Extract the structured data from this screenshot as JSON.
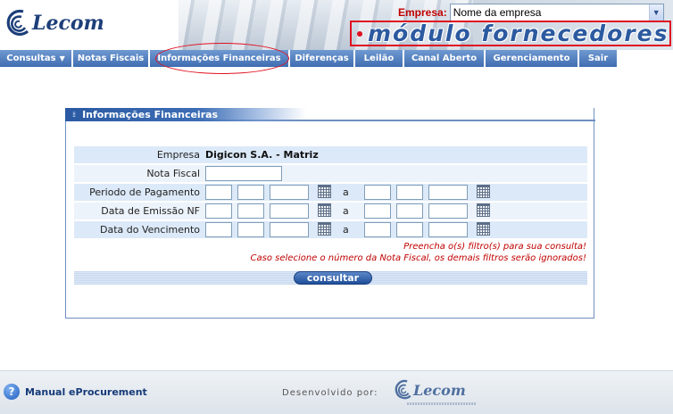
{
  "header": {
    "logo_text": "Lecom",
    "empresa_label": "Empresa:",
    "empresa_selected": "Nome da empresa",
    "module_title": "módulo fornecedores"
  },
  "nav": {
    "items": [
      {
        "label": "Consultas",
        "has_dropdown": true
      },
      {
        "label": "Notas Fiscais"
      },
      {
        "label": "Informações Financeiras",
        "active": true
      },
      {
        "label": "Diferenças"
      },
      {
        "label": "Leilão"
      },
      {
        "label": "Canal Aberto"
      },
      {
        "label": "Gerenciamento"
      },
      {
        "label": "Sair"
      }
    ]
  },
  "panel": {
    "title": "Informações Financeiras",
    "fields": {
      "empresa_label": "Empresa",
      "empresa_value": "Digicon S.A. - Matriz",
      "nota_fiscal_label": "Nota Fiscal",
      "periodo_label": "Periodo de Pagamento",
      "emissao_label": "Data de Emissão NF",
      "vencimento_label": "Data do Vencimento",
      "range_separator": "a"
    },
    "messages": {
      "line1": "Preencha o(s) filtro(s) para sua consulta!",
      "line2": "Caso selecione o número da Nota Fiscal, os demais filtros serão ignorados!"
    },
    "submit_label": "consultar"
  },
  "footer": {
    "manual_link": "Manual eProcurement",
    "developed_by": "Desenvolvido por:",
    "logo_text": "Lecom"
  },
  "colors": {
    "nav_blue": "#3f6db1",
    "alert_red": "#c00000",
    "highlight_red": "#e01020",
    "row_blue": "#dce9f8"
  }
}
